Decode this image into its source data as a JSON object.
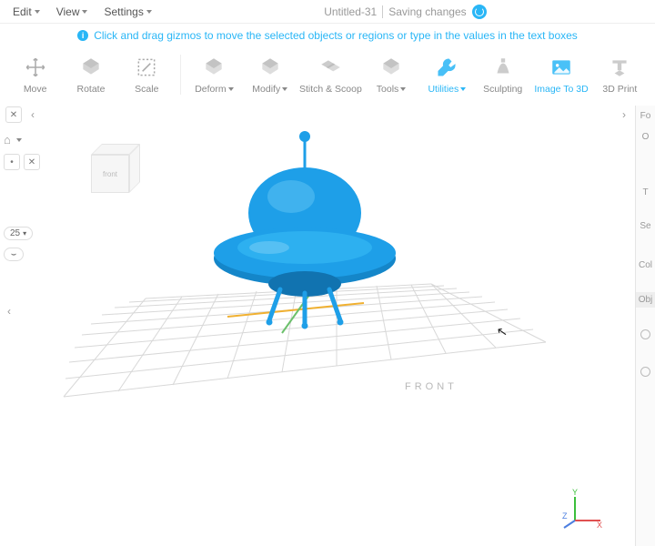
{
  "menu": {
    "edit": "Edit",
    "view": "View",
    "settings": "Settings"
  },
  "title": {
    "name": "Untitled-31",
    "status": "Saving changes"
  },
  "hint": "Click and drag gizmos to move the selected objects or regions or type in the values in the text boxes",
  "tools": {
    "move": "Move",
    "rotate": "Rotate",
    "scale": "Scale",
    "deform": "Deform",
    "modify": "Modify",
    "stitch": "Stitch & Scoop",
    "toolsMenu": "Tools",
    "utilities": "Utilities",
    "sculpting": "Sculpting",
    "imageTo3d": "Image To 3D",
    "print": "3D Print"
  },
  "left": {
    "value": "25"
  },
  "grid": {
    "label": "FRONT"
  },
  "side": {
    "fo": "Fo",
    "o": "O",
    "t": "T",
    "se": "Se",
    "col": "Col",
    "obj": "Obj"
  },
  "cube": {
    "front": "front"
  },
  "axis": {
    "x": "X",
    "y": "Y",
    "z": "Z"
  },
  "colors": {
    "accent": "#29b6f6",
    "model": "#1e9fe8"
  }
}
